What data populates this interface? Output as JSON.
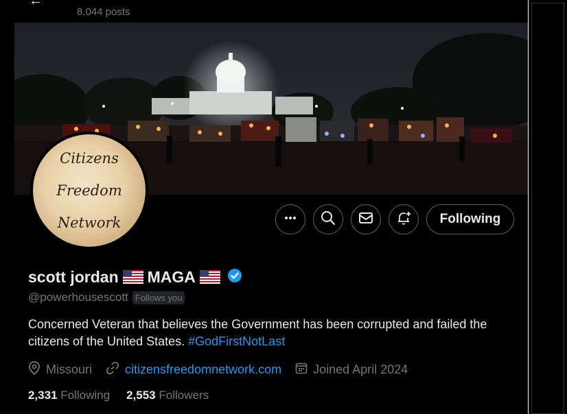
{
  "header": {
    "posts_count": "8,044 posts"
  },
  "profile": {
    "avatar_lines": [
      "Citizens",
      "Freedom",
      "Network"
    ],
    "name_part1": "scott jordan",
    "name_part2": "MAGA",
    "handle": "@powerhousescott",
    "follows_you": "Follows you",
    "bio_text": "Concerned Veteran that believes the Government has been corrupted and failed the citizens of the United States.",
    "bio_hashtag": "#GodFirstNotLast",
    "location": "Missouri",
    "website": "citizensfreedomnetwork.com",
    "joined": "Joined April 2024"
  },
  "actions": {
    "more_icon": "more-icon",
    "search_icon": "search-icon",
    "message_icon": "mail-icon",
    "notify_icon": "bell-plus-icon",
    "follow_label": "Following"
  },
  "stats": {
    "following_count": "2,331",
    "following_label": "Following",
    "followers_count": "2,553",
    "followers_label": "Followers"
  },
  "colors": {
    "background": "#000000",
    "text": "#e7e9ea",
    "muted": "#71767b",
    "accent": "#1d9bf0",
    "border": "#536471"
  }
}
